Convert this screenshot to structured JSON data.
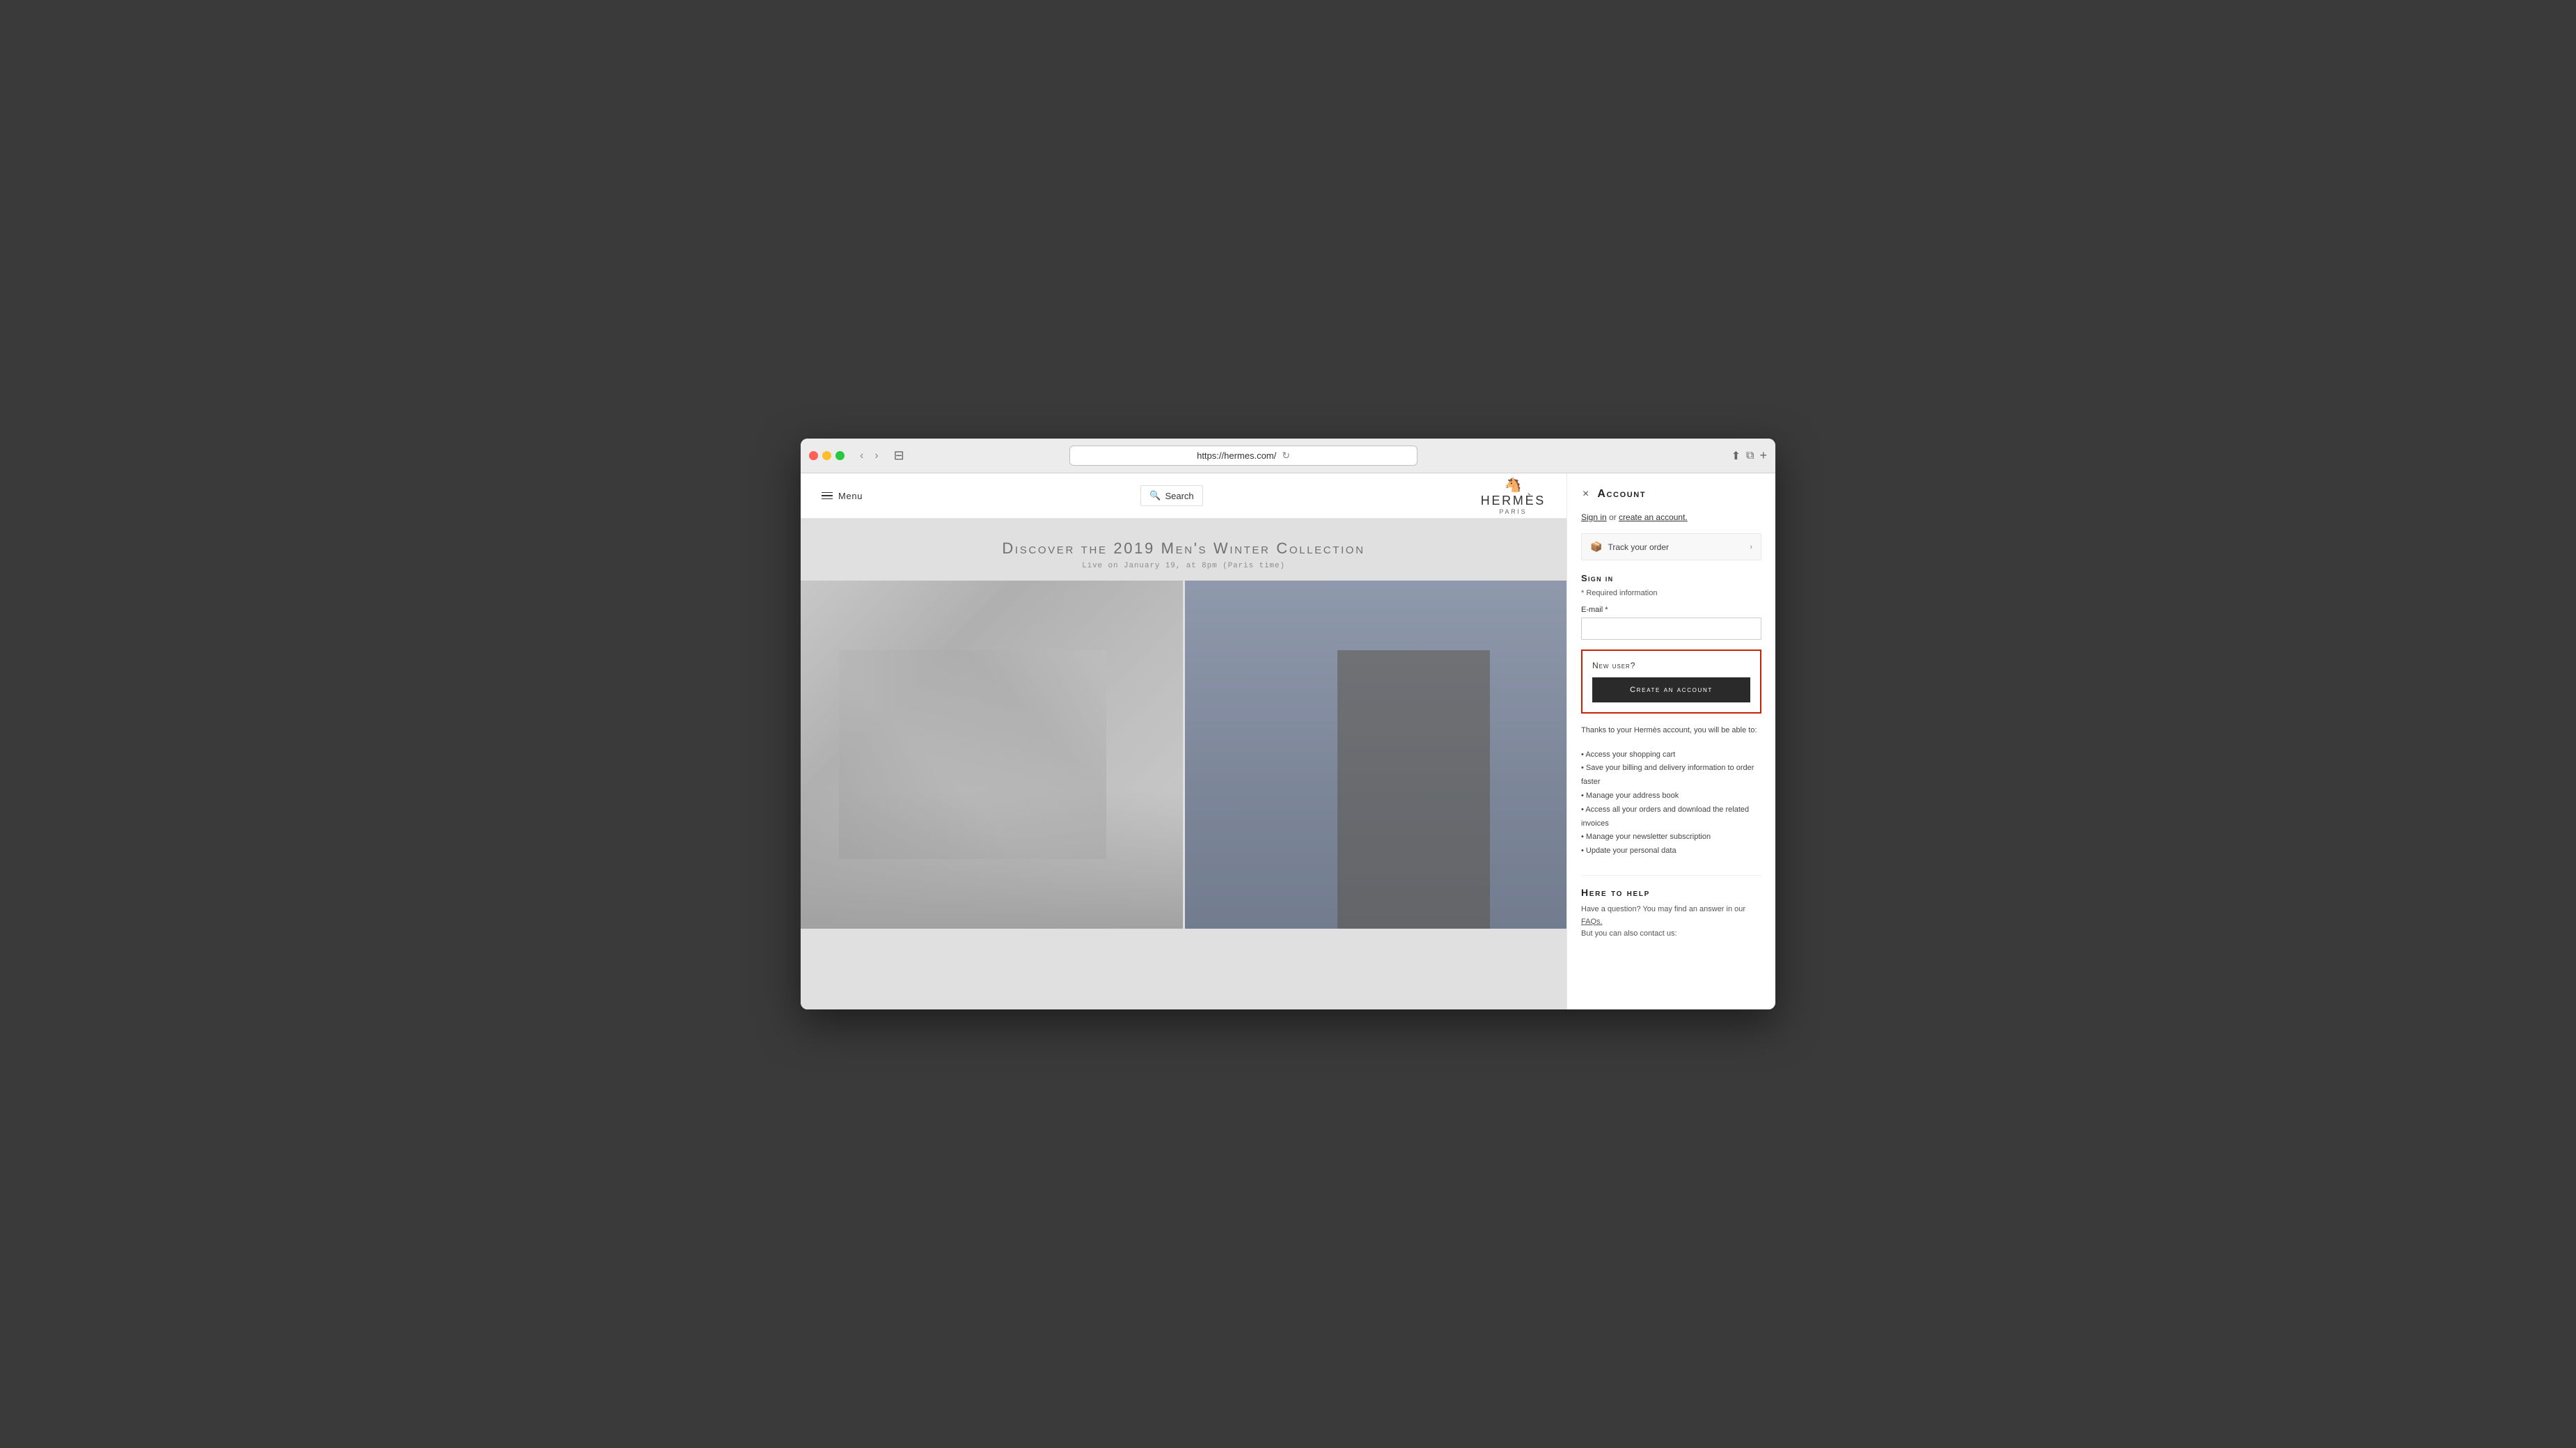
{
  "browser": {
    "url": "https://hermes.com/",
    "close_label": "×",
    "new_tab_label": "+"
  },
  "site": {
    "menu_label": "Menu",
    "search_label": "Search",
    "logo_name": "HERMÈS",
    "logo_sub": "PARIS",
    "hero_title": "Discover the 2019 Men's Winter Collection",
    "hero_subtitle": "Live on January 19, at 8pm (Paris time)"
  },
  "account_panel": {
    "close_label": "×",
    "title": "Account",
    "sign_in_text": "Sign in",
    "sign_in_or": " or ",
    "create_account_link": "create an account.",
    "track_order_label": "Track your order",
    "sign_in_section": "Sign in",
    "required_info": "* Required information",
    "email_label": "E-mail *",
    "email_placeholder": "",
    "new_user_title": "New user?",
    "create_account_btn": "Create an account",
    "benefits_intro": "Thanks to your Hermès account, you will be able to:",
    "benefits": [
      "Access your shopping cart",
      "Save your billing and delivery information to order faster",
      "Manage your address book",
      "Access all your orders and download the related invoices",
      "Manage your newsletter subscription",
      "Update your personal data"
    ],
    "help_title": "Here to help",
    "help_text": "Have a question? You may find an answer in our",
    "faqs_label": "FAQs.",
    "help_text2": "But you can also contact us:"
  }
}
